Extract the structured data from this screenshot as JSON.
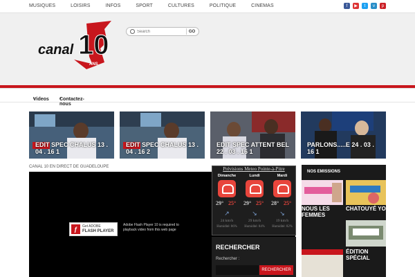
{
  "topnav": {
    "items": [
      "MUSIQUES",
      "LOISIRS",
      "INFOS",
      "SPORT",
      "CULTURES",
      "POLITIQUE",
      "CINEMAS"
    ]
  },
  "social": [
    "facebook-icon",
    "youtube-icon",
    "twitter-icon",
    "vimeo-icon",
    "pinterest-icon"
  ],
  "logo": {
    "word": "canal",
    "number": "10",
    "tag": "ANS"
  },
  "search": {
    "placeholder": "Search",
    "button": "GO"
  },
  "mainnav": {
    "items": [
      {
        "label": "Videos"
      },
      {
        "label": "Contactez-nous"
      }
    ]
  },
  "videos": [
    {
      "title": "EDIT SPEC CHALUS 13 . 04 . 16 1"
    },
    {
      "title": "EDIT SPEC CHALUS 13 . 04 . 16 2"
    },
    {
      "title": "EDIT SPEC ATTENT BEL 22 . 03 . 16 1"
    },
    {
      "title": "PARLONS.....E 24 . 03 . 16 1"
    }
  ],
  "live_label": "CANAL 10 EN DIRECT DE GUADELOUPE",
  "flash": {
    "get": "Get ADOBE",
    "product": "FLASH PLAYER",
    "message": "Adobe Flash Player 10 is required to playback video from this web page"
  },
  "weather": {
    "title": "Prévisions Meteo Pointe-à-Pitre",
    "days": [
      {
        "name": "Dimanche",
        "min": "29°",
        "max": "25°",
        "wind": "24 km/h",
        "humidity": "Humidité: 86%"
      },
      {
        "name": "Lundi",
        "min": "29°",
        "max": "25°",
        "wind": "29 km/h",
        "humidity": "Humidité: 84%"
      },
      {
        "name": "Mardi",
        "min": "28°",
        "max": "25°",
        "wind": "19 km/h",
        "humidity": "Humidité: 82%"
      }
    ],
    "colors": {
      "min": "#cccccc",
      "max": "#e8453c"
    }
  },
  "rechercher": {
    "heading": "RECHERCHER",
    "label": "Rechercher :",
    "button": "RECHERCHER"
  },
  "sidebar": {
    "heading": "NOS EMISSIONS",
    "items": [
      {
        "label": "NOUS LES FEMMES"
      },
      {
        "label": "CHATOUYÉ YO"
      },
      {
        "label": "ÉDITION SPÉCIAL"
      }
    ]
  }
}
